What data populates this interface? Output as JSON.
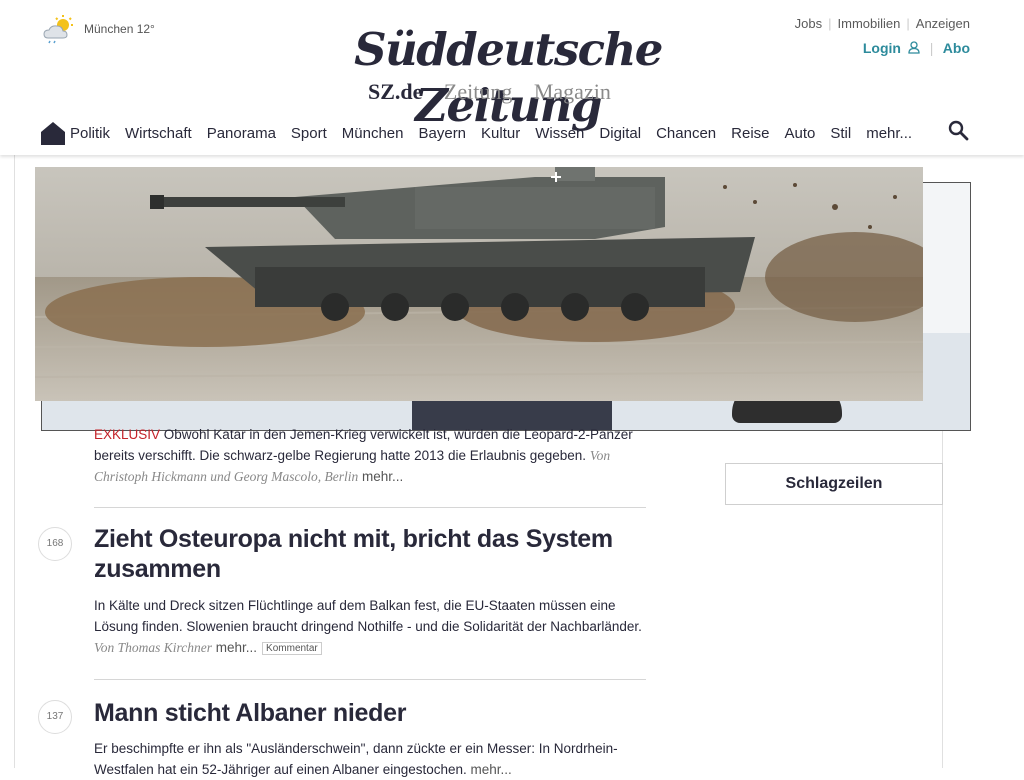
{
  "weather": {
    "icon": "sun-cloud-icon",
    "text": "München 12°"
  },
  "logo": {
    "text": "Süddeutsche Zeitung"
  },
  "sublinks": [
    "SZ.de",
    "Zeitung",
    "Magazin"
  ],
  "toplinks": [
    "Jobs",
    "Immobilien",
    "Anzeigen"
  ],
  "account": {
    "login": "Login",
    "abo": "Abo"
  },
  "nav": [
    "Politik",
    "Wirtschaft",
    "Panorama",
    "Sport",
    "München",
    "Bayern",
    "Kultur",
    "Wissen",
    "Digital",
    "Chancen",
    "Reise",
    "Auto",
    "Stil",
    "mehr..."
  ],
  "colors": {
    "accent": "#2d8b9c",
    "exclusive": "#c4232a",
    "text": "#29293a"
  },
  "articles": [
    {
      "label": "EXKLUSIV",
      "teaser": " Obwohl Katar in den Jemen-Krieg verwickelt ist, würden die Leopard-2-Panzer bereits verschifft. Die schwarz-gelbe Regierung hatte 2013 die Erlaubnis gegeben.",
      "byline": "Von Christoph Hickmann und Georg Mascolo, Berlin",
      "more": "mehr..."
    },
    {
      "comments": "168",
      "headline": "Zieht Osteuropa nicht mit, bricht das System zusammen",
      "teaser": "In Kälte und Dreck sitzen Flüchtlinge auf dem Balkan fest, die EU-Staaten müssen eine Lösung finden. Slowenien braucht dringend Nothilfe - und die Solidarität der Nachbarländer.",
      "byline": "Von Thomas Kirchner",
      "more": "mehr...",
      "tag": "Kommentar"
    },
    {
      "comments": "137",
      "headline": "Mann sticht Albaner nieder",
      "teaser": "Er beschimpfte er ihn als \"Ausländerschwein\", dann zückte er ein Messer: In Nordrhein-Westfalen hat ein 52-Jähriger auf einen Albaner eingestochen.",
      "more": "mehr..."
    }
  ],
  "sidebar": {
    "schlagzeilen": "Schlagzeilen"
  }
}
